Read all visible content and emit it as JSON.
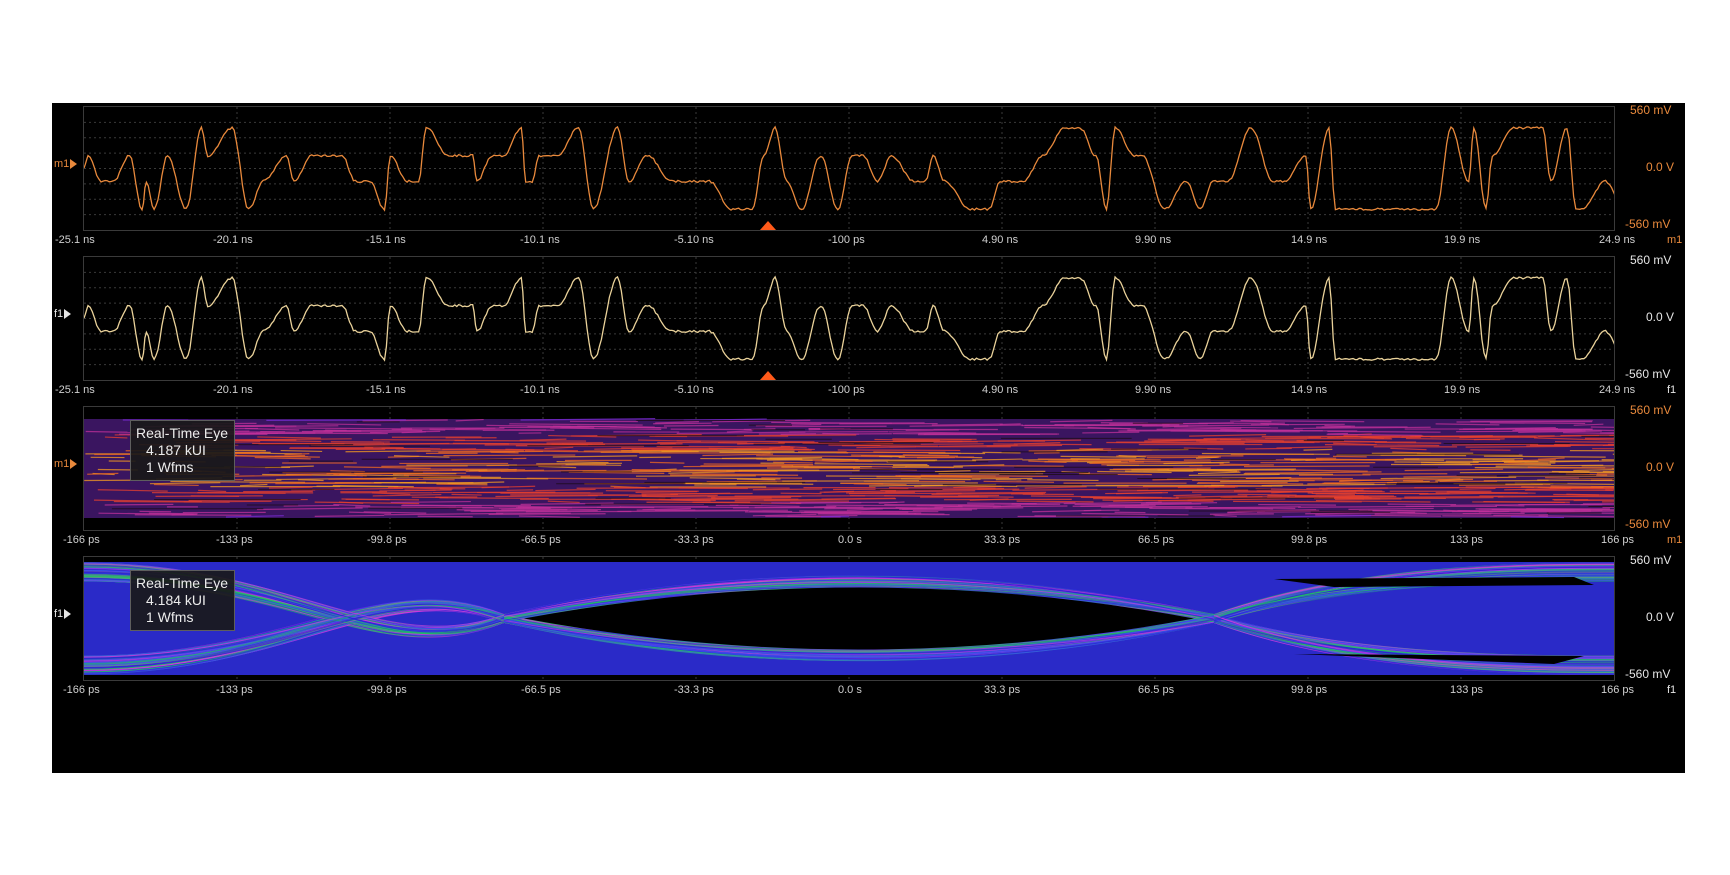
{
  "panels": [
    {
      "id": "waveform-math",
      "channel": "m1",
      "trace_color": "#e8893c",
      "scale_color": "#e8893c",
      "y_top": "560 mV",
      "y_mid": "0.0 V",
      "y_bottom": "-560 mV",
      "x_ticks": [
        "-25.1 ns",
        "-20.1 ns",
        "-15.1 ns",
        "-10.1 ns",
        "-5.10 ns",
        "-100 ps",
        "4.90 ns",
        "9.90 ns",
        "14.9 ns",
        "19.9 ns",
        "24.9 ns"
      ]
    },
    {
      "id": "waveform-filter",
      "channel": "f1",
      "trace_color": "#ead29a",
      "scale_color": "#e6e6e6",
      "y_top": "560 mV",
      "y_mid": "0.0 V",
      "y_bottom": "-560 mV",
      "x_ticks": [
        "-25.1 ns",
        "-20.1 ns",
        "-15.1 ns",
        "-10.1 ns",
        "-5.10 ns",
        "-100 ps",
        "4.90 ns",
        "9.90 ns",
        "14.9 ns",
        "19.9 ns",
        "24.9 ns"
      ]
    },
    {
      "id": "eye-math",
      "channel": "m1",
      "scale_color": "#e8893c",
      "y_top": "560 mV",
      "y_mid": "0.0 V",
      "y_bottom": "-560 mV",
      "x_ticks": [
        "-166 ps",
        "-133 ps",
        "-99.8 ps",
        "-66.5 ps",
        "-33.3 ps",
        "0.0 s",
        "33.3 ps",
        "66.5 ps",
        "99.8 ps",
        "133 ps",
        "166 ps"
      ],
      "eye": {
        "title": "Real-Time Eye",
        "ui_count": "4.187 kUI",
        "waveforms": "1 Wfms"
      }
    },
    {
      "id": "eye-filter",
      "channel": "f1",
      "scale_color": "#e6e6e6",
      "y_top": "560 mV",
      "y_mid": "0.0 V",
      "y_bottom": "-560 mV",
      "x_ticks": [
        "-166 ps",
        "-133 ps",
        "-99.8 ps",
        "-66.5 ps",
        "-33.3 ps",
        "0.0 s",
        "33.3 ps",
        "66.5 ps",
        "99.8 ps",
        "133 ps",
        "166 ps"
      ],
      "eye": {
        "title": "Real-Time Eye",
        "ui_count": "4.184 kUI",
        "waveforms": "1 Wfms"
      }
    }
  ],
  "colors": {
    "trigger": "#ff5a1a",
    "eye_closed_palette": [
      "#7b2bd6",
      "#c0309a",
      "#e8402e",
      "#f06a20",
      "#f59b22"
    ],
    "eye_open_palette": [
      "#2a1fd6",
      "#3d4ef0",
      "#1ec95a",
      "#d838e0"
    ]
  }
}
